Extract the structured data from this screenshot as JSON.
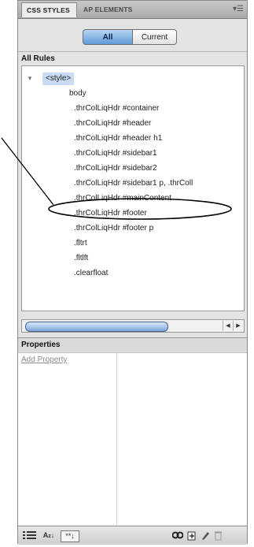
{
  "tabs": [
    {
      "label": "CSS STYLES",
      "active": true
    },
    {
      "label": "AP ELEMENTS",
      "active": false
    }
  ],
  "panel_menu_icon": "panel-menu-icon",
  "mode_toggle": {
    "all": "All",
    "current": "Current",
    "selected": "All"
  },
  "rules": {
    "header": "All Rules",
    "root": "<style>",
    "items": [
      "body",
      ".thrColLiqHdr #container",
      ".thrColLiqHdr #header",
      ".thrColLiqHdr #header h1",
      ".thrColLiqHdr #sidebar1",
      ".thrColLiqHdr #sidebar2",
      ".thrColLiqHdr #sidebar1 p, .thrColl",
      ".thrColLiqHdr #mainContent",
      ".thrColLiqHdr #footer",
      ".thrColLiqHdr #footer p",
      ".fltrt",
      ".fltlft",
      ".clearfloat"
    ],
    "highlighted": ".thrColLiqHdr #mainContent"
  },
  "properties": {
    "header": "Properties",
    "add_link": "Add Property"
  },
  "toolbar_icons": [
    "category-view-icon",
    "alphabetical-view-icon",
    "set-properties-icon",
    "attach-stylesheet-icon",
    "new-rule-icon",
    "edit-rule-icon",
    "delete-rule-icon"
  ],
  "colors": {
    "selected_blue": "#5e9ad8",
    "root_highlight": "#c7dcf4",
    "annotation": "#000000"
  }
}
